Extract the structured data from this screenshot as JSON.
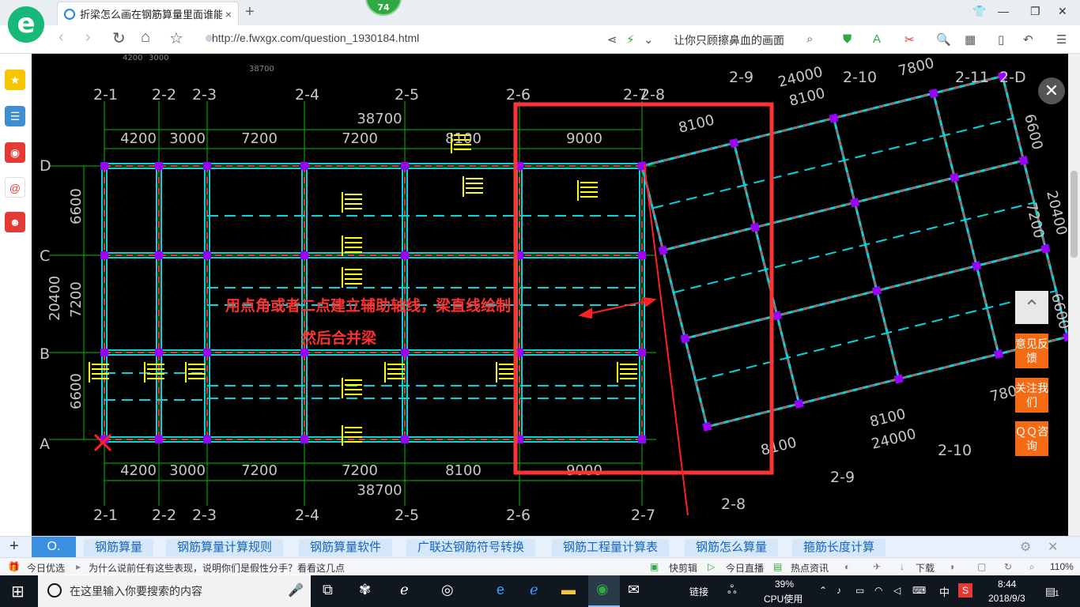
{
  "browser": {
    "badge_count": "74",
    "tab_title": "折梁怎么画在钢筋算量里面谁能",
    "tab_close": "×",
    "new_tab": "+",
    "url": "http://e.fwxgx.com/question_1930184.html",
    "search_hint": "让你只顾擦鼻血的画面"
  },
  "drawing": {
    "annotation_line1": "用点角或者二点建立辅助轴线，梁直线绘制",
    "annotation_line2": "然后合并梁",
    "left_axes": [
      "D",
      "C",
      "B",
      "A"
    ],
    "top_axes": [
      "2-1",
      "2-2",
      "2-3",
      "2-4",
      "2-5",
      "2-6",
      "2-7",
      "2-8"
    ],
    "bottom_axes": [
      "2-1",
      "2-2",
      "2-3",
      "2-4",
      "2-5",
      "2-6",
      "2-7"
    ],
    "top_dims": [
      "4200",
      "3000",
      "7200",
      "7200",
      "8100",
      "9000"
    ],
    "bottom_dims": [
      "4200",
      "3000",
      "7200",
      "7200",
      "8100",
      "9000"
    ],
    "total_top": "38700",
    "total_bottom": "38700",
    "left_dims": [
      "6600",
      "7200",
      "6600"
    ],
    "left_total": "20400",
    "right_top_axes": [
      "2-9",
      "2-10",
      "2-11",
      "2-D"
    ],
    "right_top_dims": [
      "24000",
      "8100",
      "8100",
      "7800"
    ],
    "right_side_dims": [
      "6600",
      "7200",
      "20400",
      "6600"
    ],
    "right_bottom_dims": [
      "8100",
      "24000",
      "8100",
      "7800"
    ],
    "right_bottom_axes": [
      "2-8",
      "2-9",
      "2-10"
    ],
    "top_partial": [
      "4200",
      "3000",
      "38700"
    ],
    "colors": {
      "grid": "#00c000",
      "beam": "#00d8e0",
      "red": "#ff3030",
      "purple": "#9900ff",
      "yellow": "#ffff00"
    }
  },
  "side_widget": {
    "feedback": "意见反馈",
    "follow": "关注我们",
    "qq": "ＱＱ咨询"
  },
  "tags": [
    "钢筋算量",
    "钢筋算量计算规则",
    "钢筋算量软件",
    "广联达钢筋符号转换",
    "钢筋工程量计算表",
    "钢筋怎么算量",
    "箍筋长度计算"
  ],
  "newsbar": {
    "brand": "今日优选",
    "headline": "为什么说前任有这些表现，说明你们是假性分手？看看这几点",
    "items": [
      "快剪辑",
      "今日直播",
      "热点资讯",
      "下载"
    ],
    "zoom": "110%"
  },
  "taskbar": {
    "search_placeholder": "在这里输入你要搜索的内容",
    "link_label": "链接",
    "cpu_pct": "39%",
    "cpu_label": "CPU使用",
    "ime": "中",
    "time": "8:44",
    "date": "2018/9/3",
    "notif": "1"
  }
}
